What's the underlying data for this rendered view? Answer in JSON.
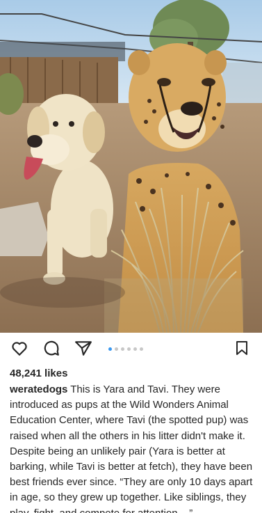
{
  "post": {
    "likes": "48,241 likes",
    "username": "weratedogs",
    "caption": "This is Yara and Tavi. They were introduced as pups at the Wild Wonders Animal Education Center, where Tavi (the spotted pup) was raised when all the others in his litter didn't make it. Despite being an unlikely pair (Yara is better at barking, while Tavi is better at fetch), they have been best friends ever since. “They are only 10 days apart in age, so they grew up together. Like siblings, they",
    "caption_cutoff": "play, fight, and compete for attention ...”",
    "carousel": {
      "count": 6,
      "active_index": 0
    }
  },
  "icons": {
    "like": "heart-icon",
    "comment": "comment-bubble-icon",
    "share": "paper-plane-icon",
    "save": "bookmark-icon"
  },
  "colors": {
    "accent": "#3897f0",
    "text": "#262626",
    "dot_inactive": "#c7c7c7"
  }
}
